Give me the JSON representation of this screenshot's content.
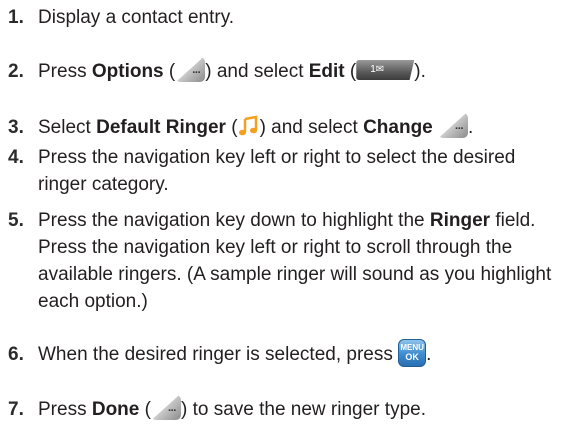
{
  "steps": [
    {
      "num": "1.",
      "text": "Display a contact entry."
    },
    {
      "num": "2.",
      "t1": "Press ",
      "b1": "Options",
      "t2": " (",
      "t3": ") and select ",
      "b2": "Edit",
      "t4": " (",
      "t5": ").",
      "key_label": "1✉"
    },
    {
      "num": "3.",
      "t1": "Select ",
      "b1": "Default Ringer",
      "t2": " (",
      "t3": ") and select ",
      "b2": "Change",
      "t4": "."
    },
    {
      "num": "4.",
      "text": "Press the navigation key left or right to select the desired ringer category."
    },
    {
      "num": "5.",
      "t1": "Press the navigation key down to highlight the ",
      "b1": "Ringer",
      "t2": " field. Press the navigation key left or right to scroll through the available ringers. (A sample ringer will sound as you highlight each option.)"
    },
    {
      "num": "6.",
      "t1": "When the desired ringer is selected, press ",
      "t2": ".",
      "menu_top": "MENU",
      "menu_bottom": "OK"
    },
    {
      "num": "7.",
      "t1": "Press ",
      "b1": "Done",
      "t2": " (",
      "t3": ") to save the new ringer type."
    }
  ],
  "icons": {
    "softkey": "right-softkey-icon",
    "key1": "key-1-icon",
    "ringer": "ringer-music-note-icon",
    "menuok": "menu-ok-key-icon",
    "ringer_color": "#f2a01d",
    "menuok_color": "#3d8ccf"
  }
}
